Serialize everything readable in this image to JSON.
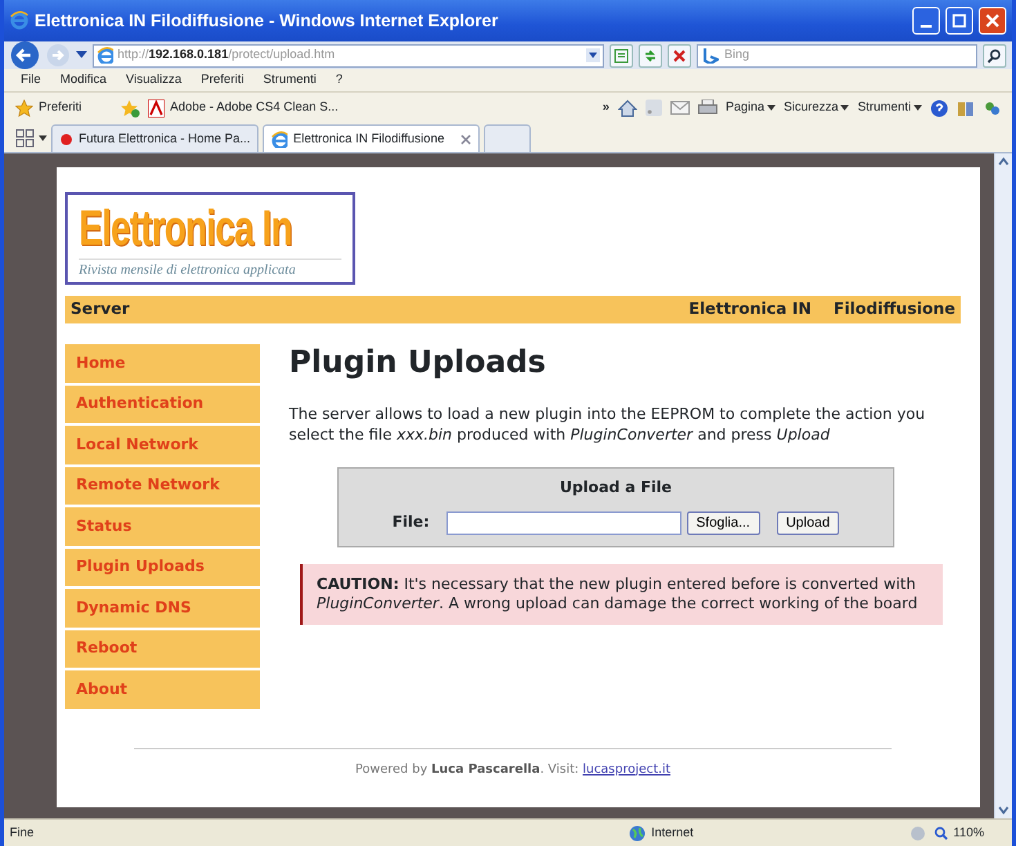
{
  "window": {
    "title": "Elettronica IN Filodiffusione - Windows Internet Explorer"
  },
  "address_bar": {
    "url": "http://**192.168.0.181**/protect/upload.htm",
    "search_placeholder": "Bing"
  },
  "menu": [
    "File",
    "Modifica",
    "Visualizza",
    "Preferiti",
    "Strumenti",
    "?"
  ],
  "favorites_bar": {
    "favorites": "Preferiti",
    "link": "Adobe - Adobe CS4 Clean S...",
    "more": "»",
    "commands": [
      "Pagina",
      "Sicurezza",
      "Strumenti"
    ]
  },
  "tabs": [
    {
      "label": "Futura Elettronica - Home Pa...",
      "selected": false
    },
    {
      "label": "Elettronica IN Filodiffusione",
      "selected": true
    }
  ],
  "page": {
    "logo": {
      "title": "Elettronica In",
      "subtitle": "Rivista mensile di elettronica applicata"
    },
    "header_bar": {
      "left": "Server",
      "right": [
        "Elettronica IN",
        "Filodiffusione"
      ]
    },
    "sidebar": [
      "Home",
      "Authentication",
      "Local Network",
      "Remote Network",
      "Status",
      "Plugin Uploads",
      "Dynamic DNS",
      "Reboot",
      "About"
    ],
    "heading": "Plugin Uploads",
    "intro": "The server allows to load a new plugin into the EEPROM to complete the action you select the file *xxx.bin* produced with *PluginConverter* and press *Upload*",
    "upload_form": {
      "title": "Upload a File",
      "label": "File:",
      "browse": "Sfoglia...",
      "submit": "Upload"
    },
    "caution": "**CAUTION:** It's necessary that the new plugin entered before is converted with *PluginConverter*. A wrong upload can damage the correct working of the board",
    "footer": {
      "text": "Powered by **Luca Pascarella**. Visit:",
      "link": "lucasproject.it"
    }
  },
  "status_bar": {
    "status": "Fine",
    "zone": "Internet",
    "zoom": "110%"
  }
}
